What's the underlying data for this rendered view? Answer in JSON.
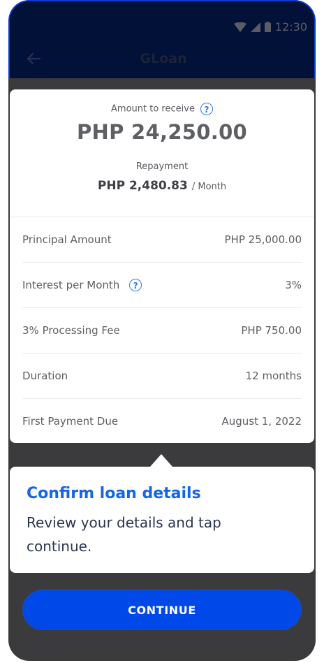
{
  "status_bar": {
    "time": "12:30"
  },
  "app_bar": {
    "title": "GLoan",
    "back_icon": "arrow-left-icon"
  },
  "summary": {
    "amount_label": "Amount to receive",
    "amount_value": "PHP 24,250.00",
    "repayment_label": "Repayment",
    "repayment_value": "PHP 2,480.83",
    "repayment_unit": "/ Month"
  },
  "details": [
    {
      "label": "Principal Amount",
      "value": "PHP 25,000.00"
    },
    {
      "label": "Interest per Month",
      "value": "3%"
    },
    {
      "label": "3% Processing Fee",
      "value": "PHP 750.00"
    },
    {
      "label": "Duration",
      "value": "12 months"
    },
    {
      "label": "First Payment Due",
      "value": "August 1, 2022"
    }
  ],
  "tooltip": {
    "title": "Confirm loan details",
    "text": "Review your details and tap continue."
  },
  "continue_label": "CONTINUE",
  "colors": {
    "accent": "#0048e8",
    "tooltip_title": "#1566e0",
    "header": "#021137"
  }
}
